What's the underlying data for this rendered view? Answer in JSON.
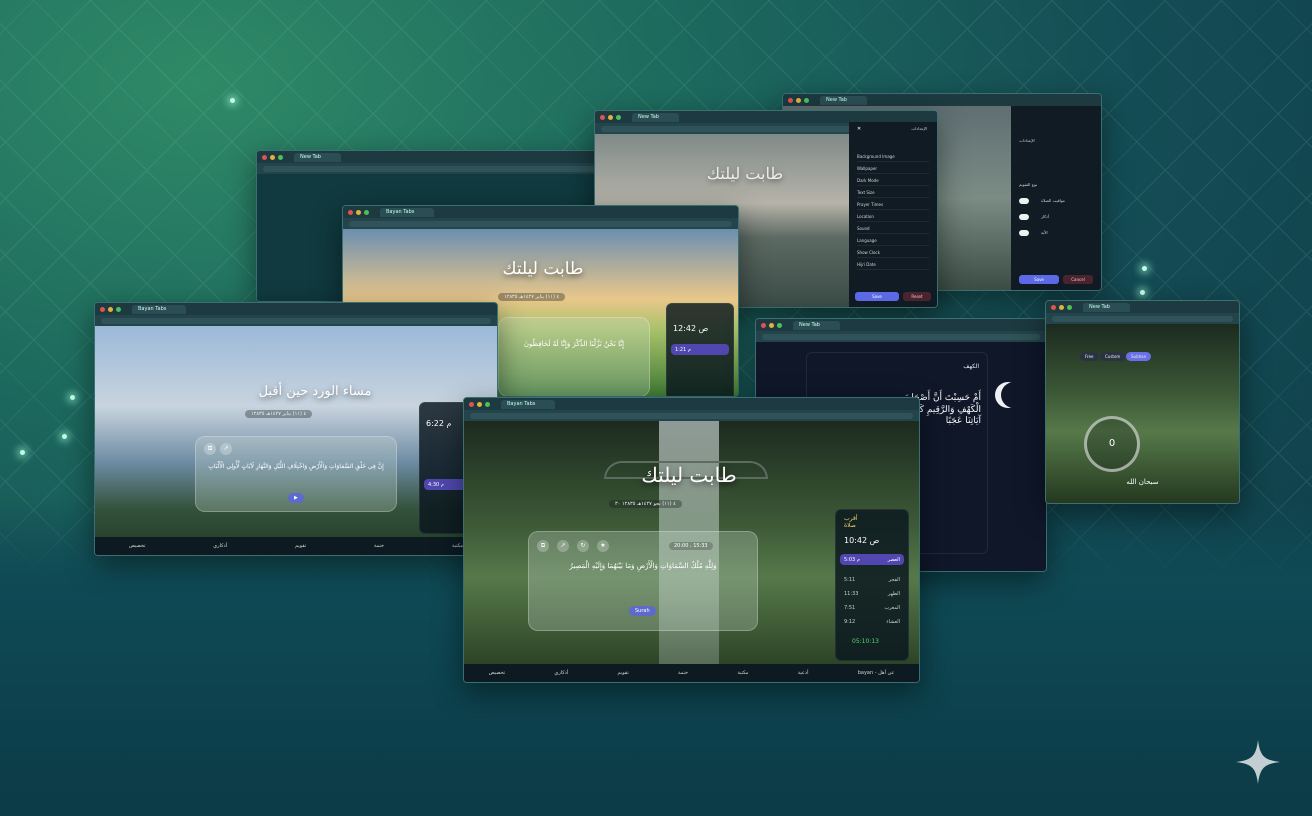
{
  "colors": {
    "accent": "#5c6ae8",
    "prayer_active": "#5048b0",
    "countdown": "#52d87a",
    "label_gold": "#f3d36d"
  },
  "windows": {
    "main": {
      "tab_title": "Bayan Tabs",
      "heading": "طابت ليلتك",
      "date_line": "٤ (١١) بجو ١٤٢٧هـ ١٢٨٣٥ ٣٠",
      "verse": "وَلِلَّهِ مُلْكُ السَّمَاوَاتِ وَالْأَرْضِ وَمَا بَيْنَهُمَا وَإِلَيْهِ الْمَصِيرُ",
      "verse_ref_label": "20:00 ، 15:33",
      "audio_pill": "Surah",
      "prayer": {
        "label": "أقرب\nصلاة",
        "next_time": "10:42 ص",
        "active_label": "العصر",
        "active_time": "5:03 م",
        "rows": [
          {
            "name": "الفجر",
            "time": "5:11"
          },
          {
            "name": "الظهر",
            "time": "11:33"
          },
          {
            "name": "المغرب",
            "time": "7:51"
          },
          {
            "name": "العشاء",
            "time": "9:12"
          }
        ],
        "countdown": "05:10:13"
      },
      "bottom_items": [
        "تخصيص",
        "أذكاري",
        "تقويم",
        "ختمة",
        "مكتبة",
        "أدعية"
      ],
      "bottom_left": "bayan - عن أهل"
    },
    "left": {
      "tab_title": "Bayan Tabs",
      "heading": "مساء الورد حين أقبل",
      "date_line": "٤ (١١) يناير ١٤٢٧هـ ١٢٨٣٥",
      "verse": "إِنَّ فِي خَلْقِ السَّمَاوَاتِ وَالْأَرْضِ وَاخْتِلَافِ اللَّيْلِ وَالنَّهَارِ لَآيَاتٍ لِّأُولِي الْأَلْبَابِ",
      "time": "6:22 م",
      "active_time": "4:30 م",
      "bottom_items": [
        "تخصيص",
        "أذكاري",
        "تقويم",
        "ختمة",
        "مكتبة"
      ]
    },
    "center_back": {
      "tab_title": "Bayan Tabs",
      "heading": "طابت ليلتك",
      "date_line": "٤ (١١) يناير ١٤٢٧هـ ١٢٨٣٥",
      "verse": "إِنَّا نَحْنُ نَزَّلْنَا الذِّكْرَ وَإِنَّا لَهُ لَحَافِظُونَ",
      "time": "12:42 ص",
      "active_time": "1:21 م"
    },
    "top_settings": {
      "heading": "طابت ليلتك",
      "panel_title": "الإعدادات",
      "rows": [
        "Background Image",
        "Wallpaper",
        "Dark Mode",
        "Text Size",
        "Prayer Times",
        "Location",
        "Sound",
        "Language",
        "Show Clock",
        "Hijri Date"
      ],
      "save": "Save",
      "cancel": "Reset"
    },
    "top_right": {
      "section_a": "الإعدادات",
      "section_b": "نوع التقويم",
      "rows": [
        "مواقيت الصلاة",
        "أذكار",
        "الآية"
      ],
      "save": "Save",
      "cancel": "Cancel"
    },
    "quran": {
      "header": "الكهف",
      "verse": "أَمْ حَسِبْتَ أَنَّ أَصْحَابَ الْكَهْفِ وَالرَّقِيمِ كَانُوا مِنْ آيَاتِنَا عَجَبًا"
    },
    "tasbih": {
      "chips": [
        "Free",
        "Custom",
        "Subhan"
      ],
      "count": "0",
      "label": "سبحان الله"
    }
  }
}
